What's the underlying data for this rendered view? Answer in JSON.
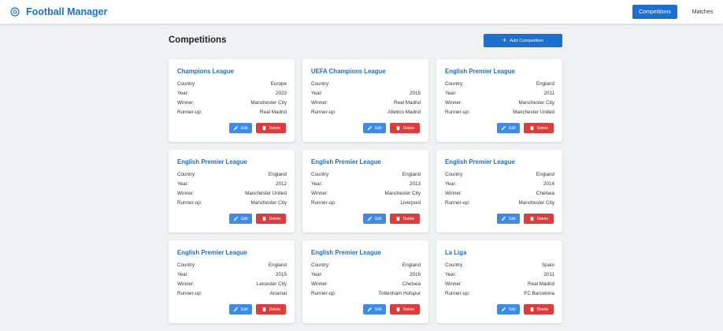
{
  "header": {
    "app_title": "Football Manager",
    "logo_icon": "football-icon",
    "nav": [
      {
        "label": "Competitions",
        "active": true
      },
      {
        "label": "Matches",
        "active": false
      }
    ],
    "accent_color": "#1a6fd1"
  },
  "main": {
    "title": "Competitions",
    "add_button": {
      "label": "Add Competition",
      "icon": "plus-icon"
    },
    "field_labels": {
      "country": "Country:",
      "year": "Year:",
      "winner": "Winner:",
      "runner_up": "Runner-up:"
    },
    "edit_label": "Edit",
    "delete_label": "Delete",
    "cards": [
      {
        "name": "Champions League",
        "country": "Europe",
        "year": "2023",
        "winner": "Manchester City",
        "runner_up": "Real Madrid"
      },
      {
        "name": "UEFA Champions League",
        "country": "",
        "year": "2015",
        "winner": "Real Madrid",
        "runner_up": "Atletico Madrid"
      },
      {
        "name": "English Premier League",
        "country": "England",
        "year": "2011",
        "winner": "Manchester City",
        "runner_up": "Manchester United"
      },
      {
        "name": "English Premier League",
        "country": "England",
        "year": "2012",
        "winner": "Manchester United",
        "runner_up": "Manchester City"
      },
      {
        "name": "English Premier League",
        "country": "England",
        "year": "2013",
        "winner": "Manchester City",
        "runner_up": "Liverpool"
      },
      {
        "name": "English Premier League",
        "country": "England",
        "year": "2014",
        "winner": "Chelsea",
        "runner_up": "Manchester City"
      },
      {
        "name": "English Premier League",
        "country": "England",
        "year": "2015",
        "winner": "Leicester City",
        "runner_up": "Arsenal"
      },
      {
        "name": "English Premier League",
        "country": "England",
        "year": "2016",
        "winner": "Chelsea",
        "runner_up": "Tottenham Hotspur"
      },
      {
        "name": "La Liga",
        "country": "Spain",
        "year": "2011",
        "winner": "Real Madrid",
        "runner_up": "FC Barcelona"
      }
    ]
  }
}
